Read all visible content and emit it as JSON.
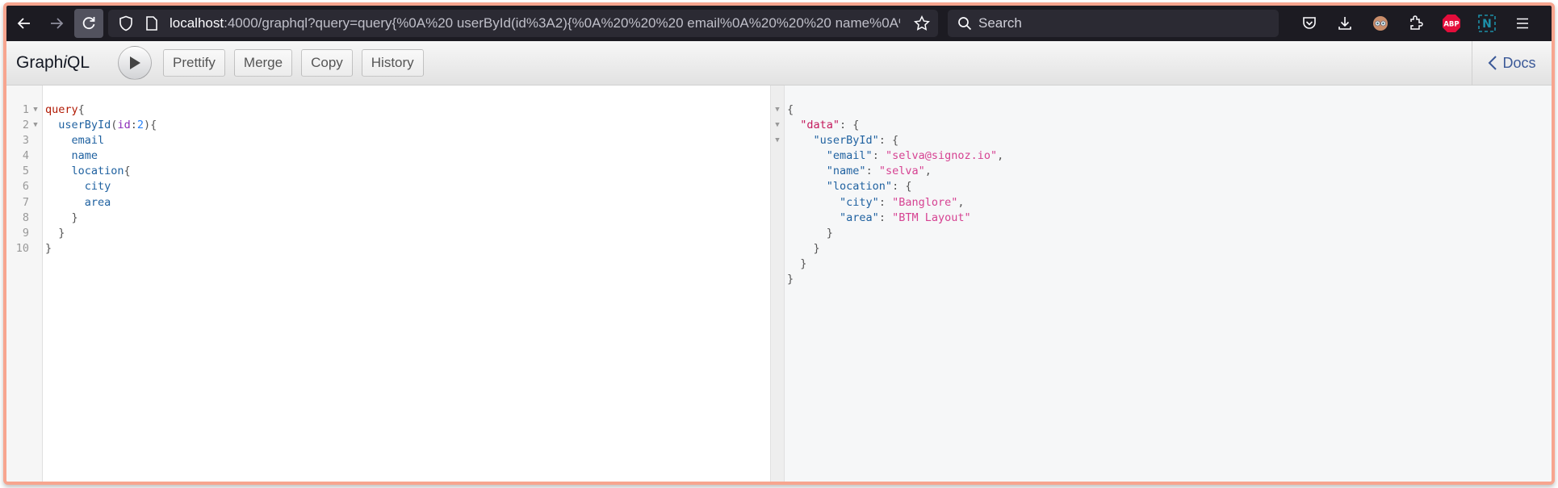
{
  "browser": {
    "url_host": "localhost",
    "url_rest": ":4000/graphql?query=query{%0A%20 userById(id%3A2){%0A%20%20%20 email%0A%20%20%20 name%0A%",
    "search_placeholder": "Search",
    "extensions": [
      "pocket-icon",
      "downloads-icon",
      "avatar-extension-icon",
      "extensions-icon",
      "adblock-plus-icon",
      "n-extension-icon",
      "menu-icon"
    ],
    "abp_label": "ABP",
    "n_label": "N"
  },
  "graphiql": {
    "title_pre": "Graph",
    "title_i": "i",
    "title_post": "QL",
    "buttons": {
      "prettify": "Prettify",
      "merge": "Merge",
      "copy": "Copy",
      "history": "History"
    },
    "docs_label": "Docs"
  },
  "query_editor": {
    "lines": [
      {
        "n": "1",
        "fold": true
      },
      {
        "n": "2",
        "fold": true
      },
      {
        "n": "3"
      },
      {
        "n": "4"
      },
      {
        "n": "5"
      },
      {
        "n": "6"
      },
      {
        "n": "7"
      },
      {
        "n": "8"
      },
      {
        "n": "9"
      },
      {
        "n": "10"
      }
    ],
    "tokens": {
      "keyword": "query",
      "field_root": "userById",
      "arg_name": "id",
      "arg_value": "2",
      "f_email": "email",
      "f_name": "name",
      "f_location": "location",
      "f_city": "city",
      "f_area": "area"
    }
  },
  "result": {
    "data_key": "\"data\"",
    "user_key": "\"userById\"",
    "email_key": "\"email\"",
    "email_val": "\"selva@signoz.io\"",
    "name_key": "\"name\"",
    "name_val": "\"selva\"",
    "location_key": "\"location\"",
    "city_key": "\"city\"",
    "city_val": "\"Banglore\"",
    "area_key": "\"area\"",
    "area_val": "\"BTM Layout\""
  },
  "colors": {
    "frame_border": "#f7a58f",
    "keyword": "#b11a04",
    "field": "#1f61a0",
    "argument": "#8b2bb9",
    "number": "#2882f9",
    "string": "#d64292",
    "data_key": "#c41a5d",
    "docs_link": "#3b5998"
  }
}
